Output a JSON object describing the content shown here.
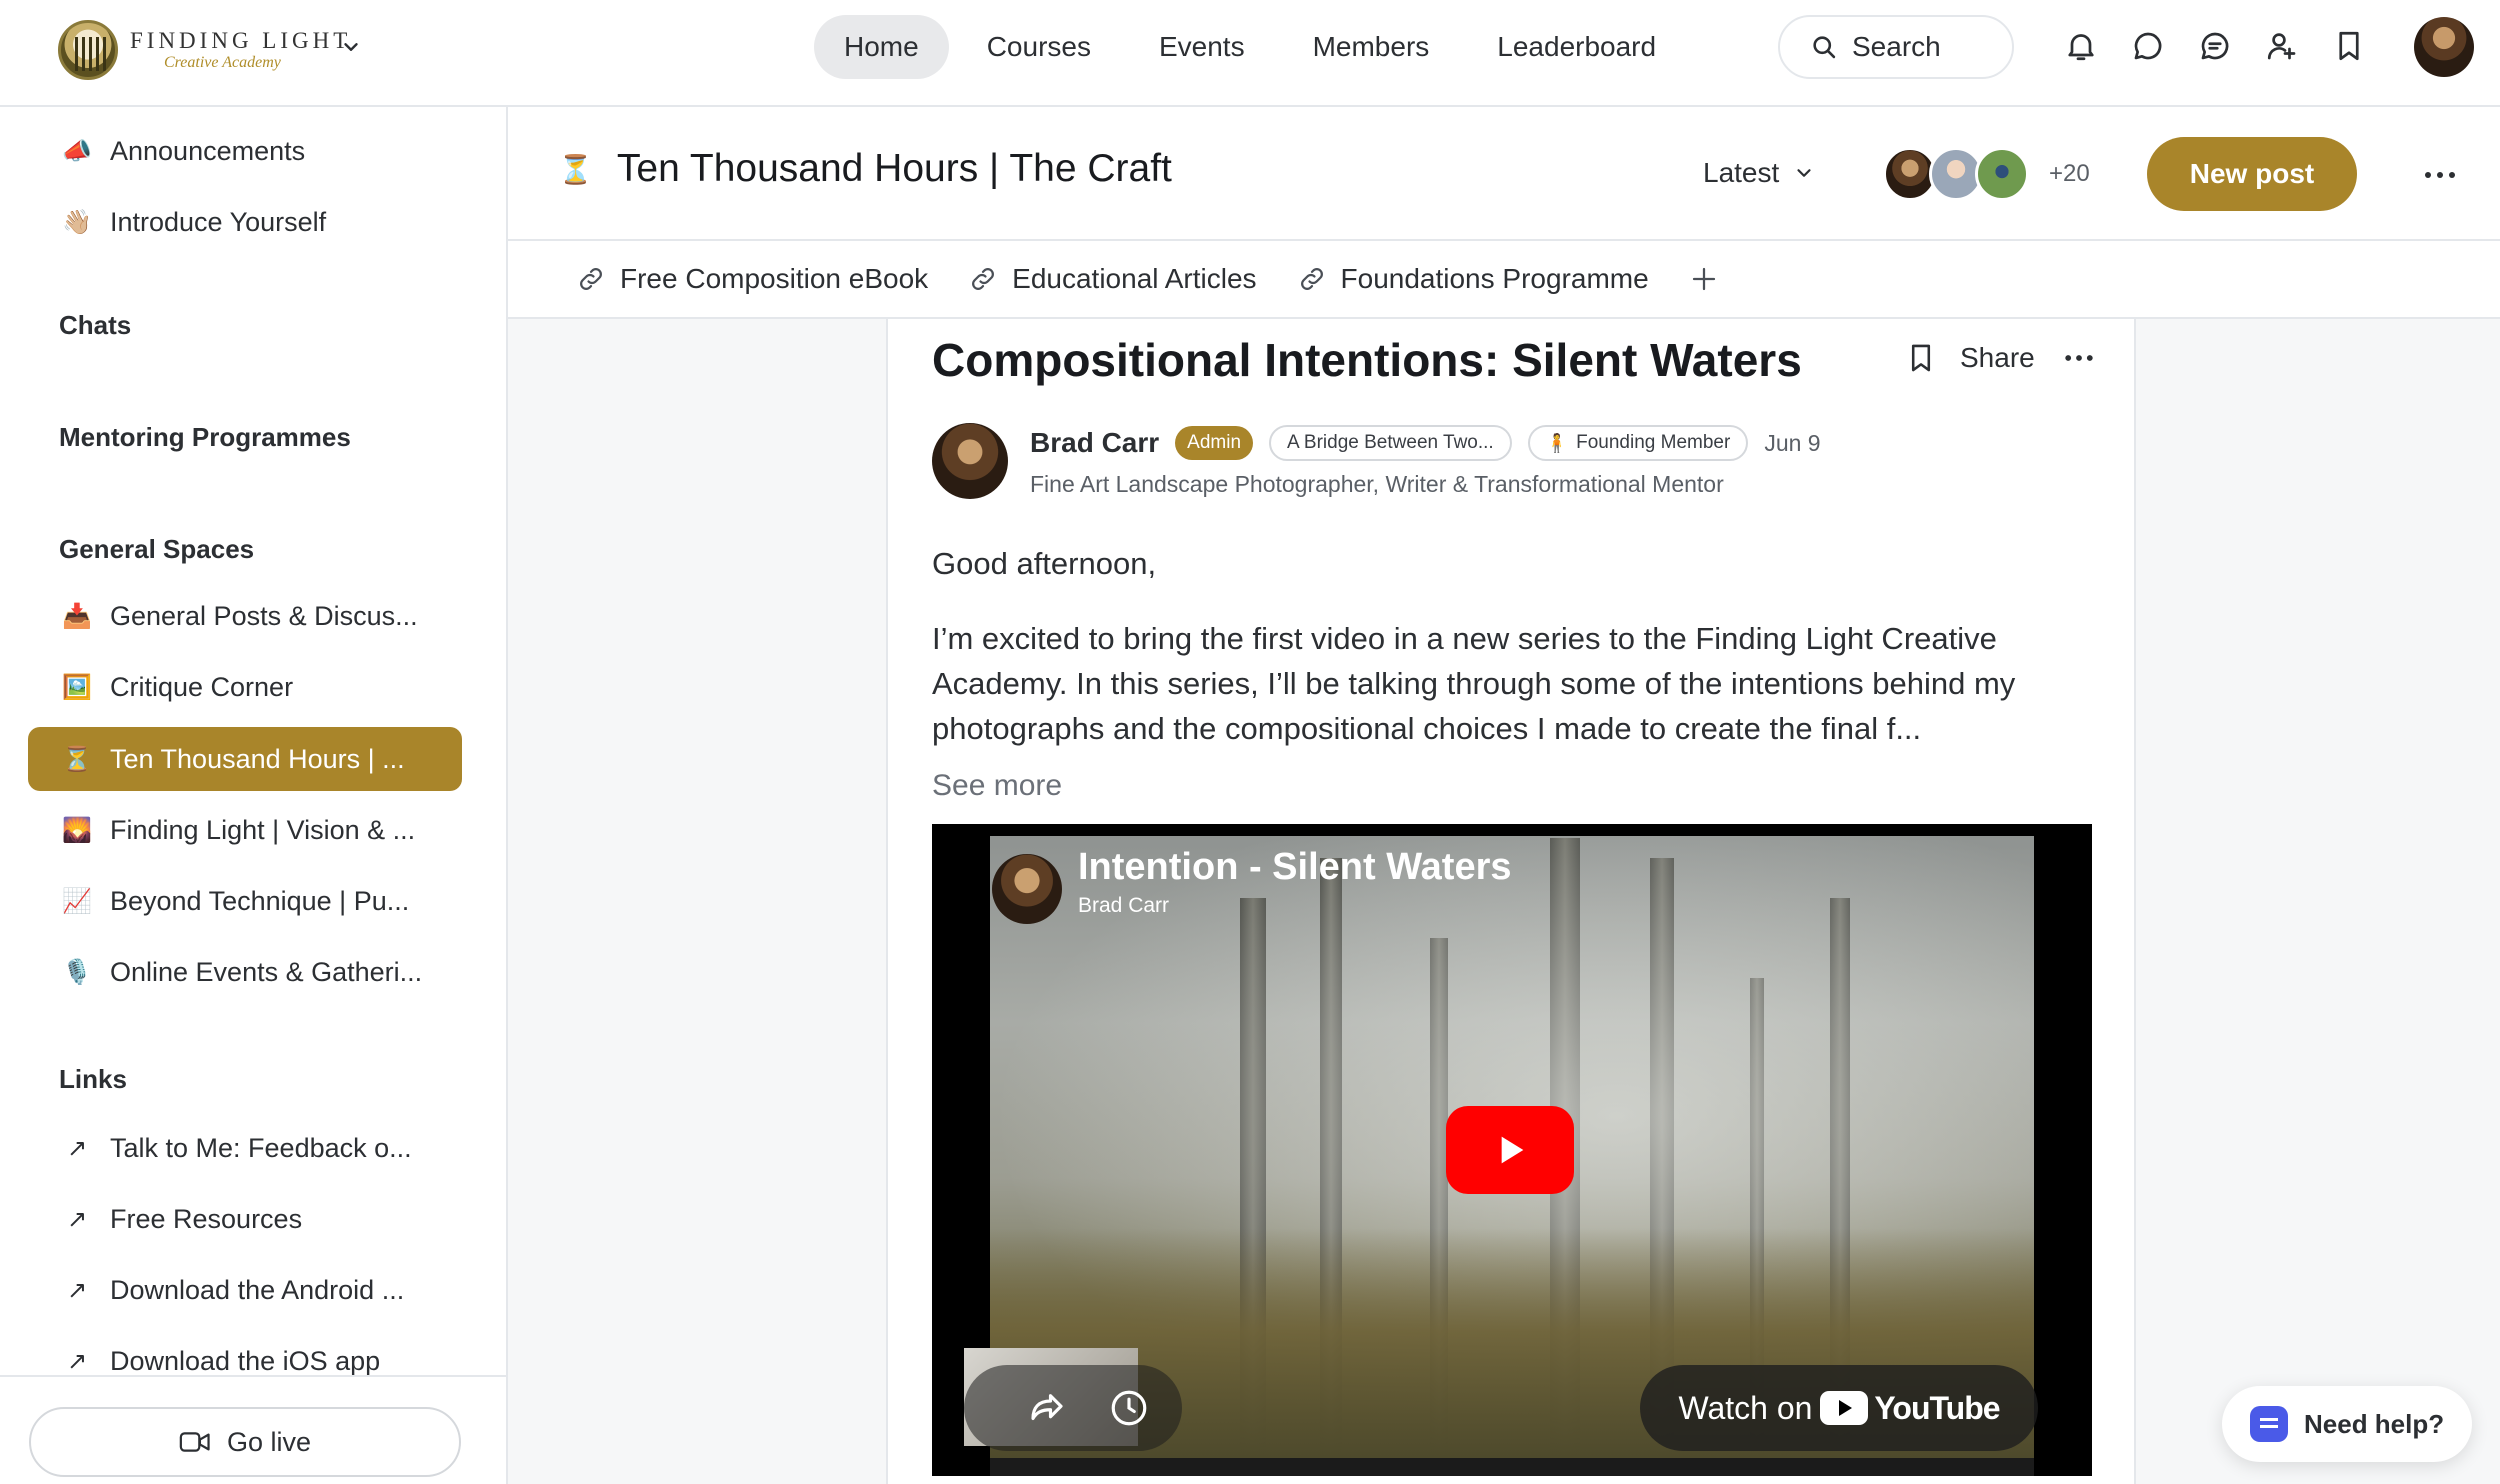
{
  "brand": {
    "name": "FINDING LIGHT",
    "tagline": "Creative Academy"
  },
  "nav": {
    "items": [
      "Home",
      "Courses",
      "Events",
      "Members",
      "Leaderboard"
    ],
    "active": "Home",
    "search_label": "Search"
  },
  "top_icons": [
    "bell-icon",
    "chat-bubble-icon",
    "messages-icon",
    "add-user-icon",
    "bookmark-icon"
  ],
  "sidebar": {
    "top_items": [
      {
        "emoji": "📣",
        "label": "Announcements"
      },
      {
        "emoji": "👋🏼",
        "label": "Introduce Yourself"
      }
    ],
    "headings": {
      "chats": "Chats",
      "mentoring": "Mentoring Programmes",
      "general": "General Spaces",
      "links": "Links"
    },
    "spaces": [
      {
        "emoji": "📥",
        "label": "General Posts & Discus..."
      },
      {
        "emoji": "🖼️",
        "label": "Critique Corner"
      },
      {
        "emoji": "⏳",
        "label": "Ten Thousand Hours | ..."
      },
      {
        "emoji": "🌄",
        "label": "Finding Light | Vision & ..."
      },
      {
        "emoji": "📈",
        "label": "Beyond Technique | Pu..."
      },
      {
        "emoji": "🎙️",
        "label": "Online Events & Gatheri..."
      }
    ],
    "active_space": "Ten Thousand Hours | ...",
    "links": [
      "Talk to Me: Feedback o...",
      "Free Resources",
      "Download the Android ...",
      "Download the iOS app"
    ],
    "go_live": "Go live"
  },
  "space": {
    "emoji": "⏳",
    "title": "Ten Thousand Hours | The Craft",
    "sort_label": "Latest",
    "member_overflow": "+20",
    "new_post": "New post",
    "links": [
      "Free Composition eBook",
      "Educational Articles",
      "Foundations Programme"
    ]
  },
  "post": {
    "title": "Compositional Intentions: Silent Waters",
    "share": "Share",
    "author": {
      "name": "Brad Carr",
      "badge": "Admin",
      "tag_one": "A Bridge Between Two...",
      "tag_two": "Founding Member",
      "date": "Jun 9",
      "headline": "Fine Art Landscape Photographer, Writer & Transformational Mentor"
    },
    "greeting": "Good afternoon,",
    "paragraph": "I’m excited to bring the first video in a new series to the Finding Light Creative Academy. In this series, I’ll be talking through some of the intentions behind my photographs and the compositional choices I made to create the final f...",
    "see_more": "See more",
    "video": {
      "title": "Intention - Silent Waters",
      "author": "Brad Carr",
      "watch_on": "Watch on",
      "platform": "YouTube"
    }
  },
  "help": {
    "label": "Need help?"
  },
  "colors": {
    "accent": "#a9852a",
    "youtube_red": "#ff0000"
  }
}
